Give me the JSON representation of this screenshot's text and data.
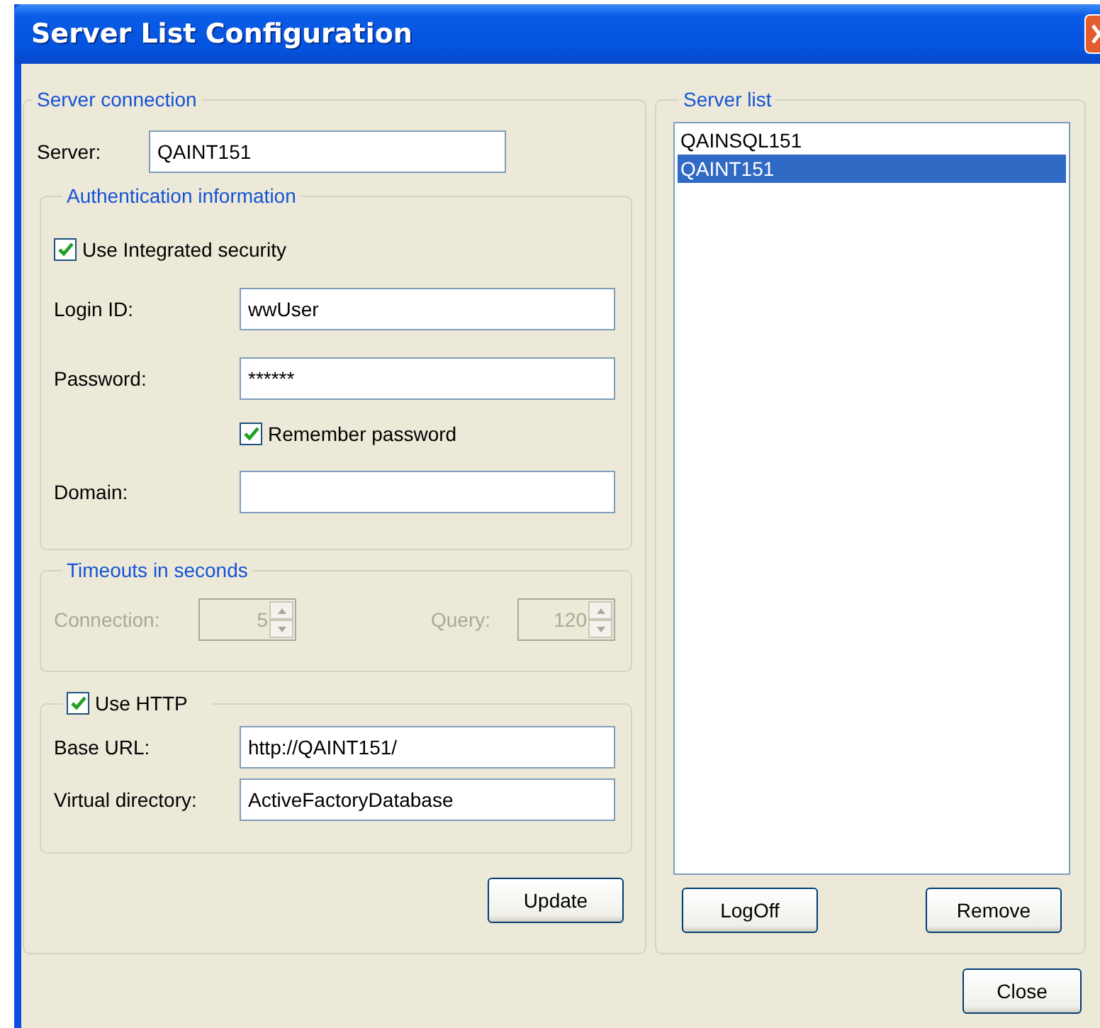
{
  "window": {
    "title": "Server List Configuration"
  },
  "server_connection": {
    "legend": "Server connection",
    "server": {
      "label": "Server:",
      "value": "QAINT151"
    },
    "authentication": {
      "legend": "Authentication information",
      "integrated_security": {
        "label": "Use Integrated security",
        "checked": true
      },
      "login_id": {
        "label": "Login ID:",
        "value": "wwUser"
      },
      "password": {
        "label": "Password:",
        "value": "******"
      },
      "remember_password": {
        "label": "Remember password",
        "checked": true
      },
      "domain": {
        "label": "Domain:"
      }
    },
    "timeouts": {
      "legend": "Timeouts in seconds",
      "disabled": true,
      "connection": {
        "label": "Connection:",
        "value": "5"
      },
      "query": {
        "label": "Query:",
        "value": "120"
      }
    },
    "http": {
      "label": "Use HTTP",
      "checked": true,
      "base_url": {
        "label": "Base URL:",
        "value": "http://QAINT151/"
      },
      "virtual_directory": {
        "label": "Virtual directory:",
        "value": "ActiveFactoryDatabase"
      }
    },
    "update_button": "Update"
  },
  "server_list": {
    "legend": "Server list",
    "items": [
      {
        "label": "QAINSQL151",
        "selected": false
      },
      {
        "label": "QAINT151",
        "selected": true
      }
    ],
    "buttons": [
      "LogOff",
      "Remove"
    ]
  },
  "close_button": "Close"
}
